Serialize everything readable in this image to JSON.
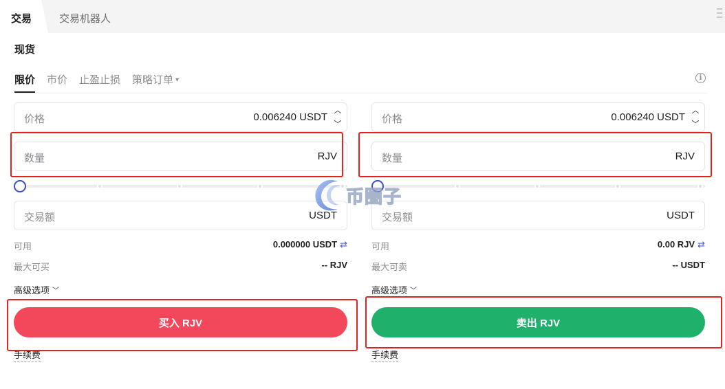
{
  "tabs": {
    "active": "交易",
    "other": "交易机器人"
  },
  "mode_label": "现货",
  "order_types": [
    "限价",
    "市价",
    "止盈止损",
    "策略订单"
  ],
  "buy": {
    "price_label": "价格",
    "price_value": "0.006240 USDT",
    "qty_label": "数量",
    "qty_unit": "RJV",
    "amount_label": "交易额",
    "amount_unit": "USDT",
    "available_label": "可用",
    "available_value": "0.000000 USDT",
    "max_label": "最大可买",
    "max_value": "-- RJV",
    "advanced_label": "高级选项",
    "button_label": "买入 RJV",
    "fee_label": "手续费",
    "slider_level": 0
  },
  "sell": {
    "price_label": "价格",
    "price_value": "0.006240 USDT",
    "qty_label": "数量",
    "qty_unit": "RJV",
    "amount_label": "交易额",
    "amount_unit": "USDT",
    "available_label": "可用",
    "available_value": "0.00 RJV",
    "max_label": "最大可卖",
    "max_value": "-- USDT",
    "advanced_label": "高级选项",
    "button_label": "卖出 RJV",
    "fee_label": "手续费",
    "slider_level": 0
  },
  "watermark": "币圈子",
  "colors": {
    "buy": "#f3475c",
    "sell": "#1fb06c",
    "highlight": "#e02424",
    "slider_thumb": "#3b4bd3"
  },
  "icons": {
    "swap": "⇄",
    "caret": "▾",
    "up": "︿",
    "down": "﹀"
  }
}
